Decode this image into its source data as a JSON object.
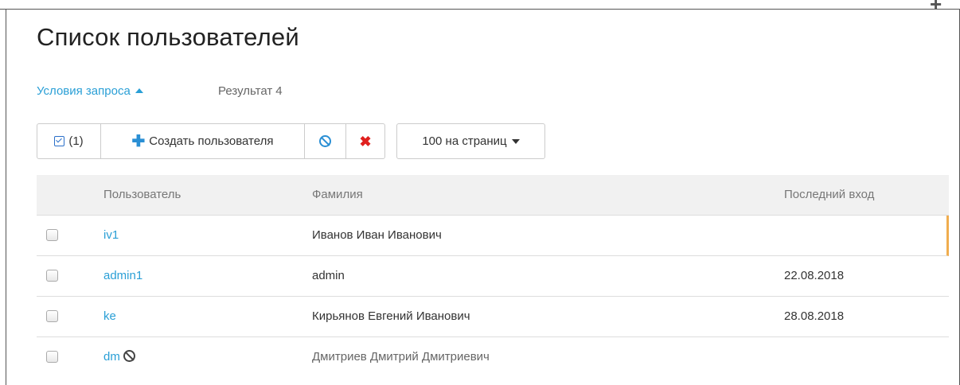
{
  "page": {
    "title": "Список пользователей"
  },
  "query": {
    "toggle_label": "Условия запроса",
    "result_label": "Результат",
    "result_count": "4"
  },
  "toolbar": {
    "select_count": "(1)",
    "create_label": "Создать пользователя",
    "block_icon": "ban-icon",
    "delete_icon": "x-icon",
    "per_page_label": "100 на страниц"
  },
  "table": {
    "columns": [
      "Пользователь",
      "Фамилия",
      "Последний вход"
    ],
    "rows": [
      {
        "user": "iv1",
        "full_name": "Иванов Иван Иванович",
        "last_login": "",
        "blocked": false
      },
      {
        "user": "admin1",
        "full_name": "admin",
        "last_login": "22.08.2018",
        "blocked": false
      },
      {
        "user": "ke",
        "full_name": "Кирьянов Евгений Иванович",
        "last_login": "28.08.2018",
        "blocked": false
      },
      {
        "user": "dm",
        "full_name": "Дмитриев Дмитрий Дмитриевич",
        "last_login": "",
        "blocked": true
      }
    ]
  },
  "colors": {
    "link": "#2a9fd6",
    "create_icon": "#2a8fd4",
    "delete_icon": "#e0201e",
    "row_highlight": "#f0ad4e"
  }
}
